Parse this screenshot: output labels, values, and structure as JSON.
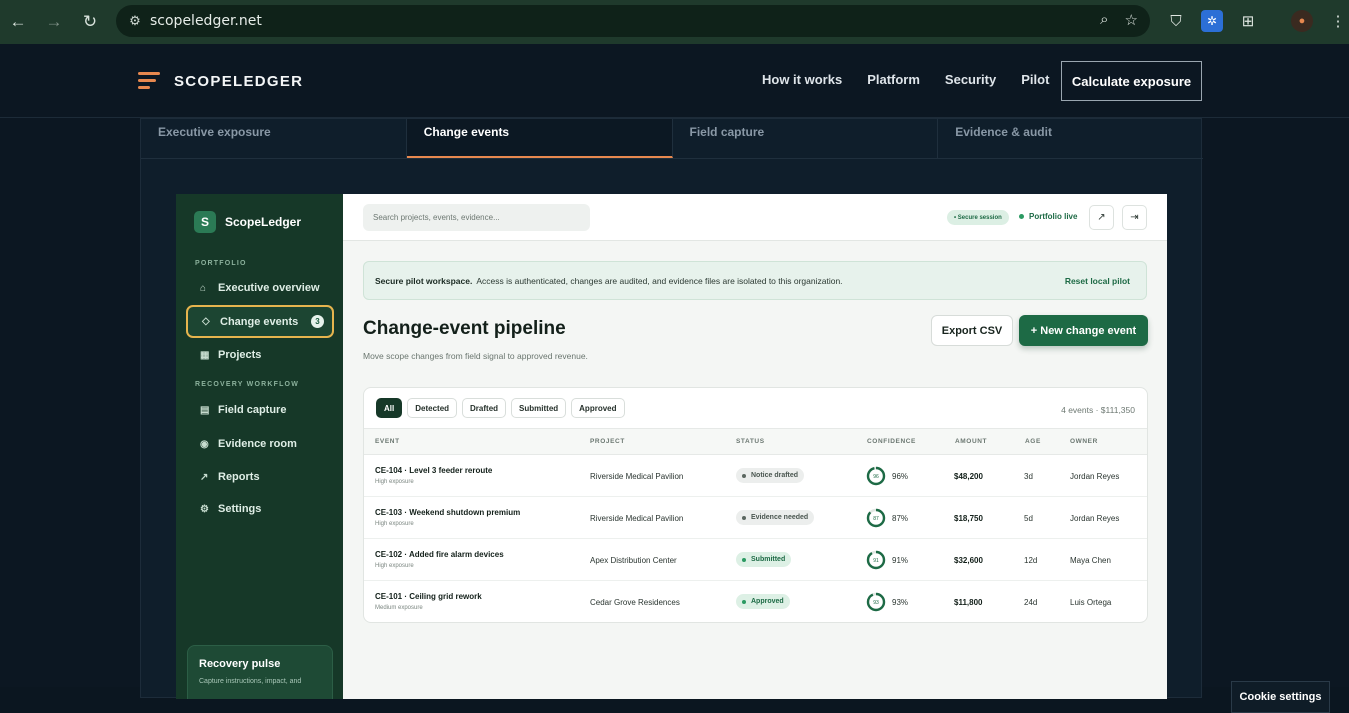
{
  "browser": {
    "url": "scopeledger.net"
  },
  "site": {
    "brand": "SCOPELEDGER",
    "nav": [
      "How it works",
      "Platform",
      "Security",
      "Pilot"
    ],
    "cta": "Calculate exposure",
    "tabs": [
      "Executive exposure",
      "Change events",
      "Field capture",
      "Evidence & audit"
    ]
  },
  "sidebar": {
    "brand_letter": "S",
    "brand": "ScopeLedger",
    "section1": "PORTFOLIO",
    "items1": [
      {
        "label": "Executive overview",
        "icon": "⌂"
      },
      {
        "label": "Change events",
        "icon": "◇",
        "count": "3"
      },
      {
        "label": "Projects",
        "icon": "▦"
      }
    ],
    "section2": "RECOVERY WORKFLOW",
    "items2": [
      {
        "label": "Field capture",
        "icon": "▤"
      },
      {
        "label": "Evidence room",
        "icon": "◉"
      },
      {
        "label": "Reports",
        "icon": "↗"
      },
      {
        "label": "Settings",
        "icon": "⚙"
      }
    ],
    "pulse_title": "Recovery pulse",
    "pulse_sub": "Capture instructions, impact, and"
  },
  "topbar": {
    "search_placeholder": "Search projects, events, evidence...",
    "secure": "• Secure session",
    "live": "Portfolio live",
    "icon1": "↗",
    "icon2": "⇥"
  },
  "banner": {
    "bold": "Secure pilot workspace.",
    "text": "Access is authenticated, changes are audited, and evidence files are isolated to this organization.",
    "reset": "Reset local pilot"
  },
  "page": {
    "title": "Change-event pipeline",
    "subtitle": "Move scope changes from field signal to approved revenue.",
    "export": "Export CSV",
    "new": "+ New change event"
  },
  "table": {
    "filters": [
      "All",
      "Detected",
      "Drafted",
      "Submitted",
      "Approved"
    ],
    "summary": "4 events · $111,350",
    "headers": [
      "EVENT",
      "PROJECT",
      "STATUS",
      "CONFIDENCE",
      "AMOUNT",
      "AGE",
      "OWNER"
    ],
    "rows": [
      {
        "event": "CE-104 · Level 3 feeder reroute",
        "exposure": "High exposure",
        "project": "Riverside Medical Pavilion",
        "status": "Notice drafted",
        "status_color": "gray",
        "ring": "96",
        "confidence": "96%",
        "amount": "$48,200",
        "age": "3d",
        "owner": "Jordan Reyes"
      },
      {
        "event": "CE-103 · Weekend shutdown premium",
        "exposure": "High exposure",
        "project": "Riverside Medical Pavilion",
        "status": "Evidence needed",
        "status_color": "gray",
        "ring": "87",
        "confidence": "87%",
        "amount": "$18,750",
        "age": "5d",
        "owner": "Jordan Reyes"
      },
      {
        "event": "CE-102 · Added fire alarm devices",
        "exposure": "High exposure",
        "project": "Apex Distribution Center",
        "status": "Submitted",
        "status_color": "green",
        "ring": "91",
        "confidence": "91%",
        "amount": "$32,600",
        "age": "12d",
        "owner": "Maya Chen"
      },
      {
        "event": "CE-101 · Ceiling grid rework",
        "exposure": "Medium exposure",
        "project": "Cedar Grove Residences",
        "status": "Approved",
        "status_color": "green",
        "ring": "93",
        "confidence": "93%",
        "amount": "$11,800",
        "age": "24d",
        "owner": "Luis Ortega"
      }
    ]
  },
  "cookie": "Cookie settings",
  "colors": {
    "accent": "#1d6a45",
    "orange": "#e7884f",
    "sidebar": "#163828"
  }
}
